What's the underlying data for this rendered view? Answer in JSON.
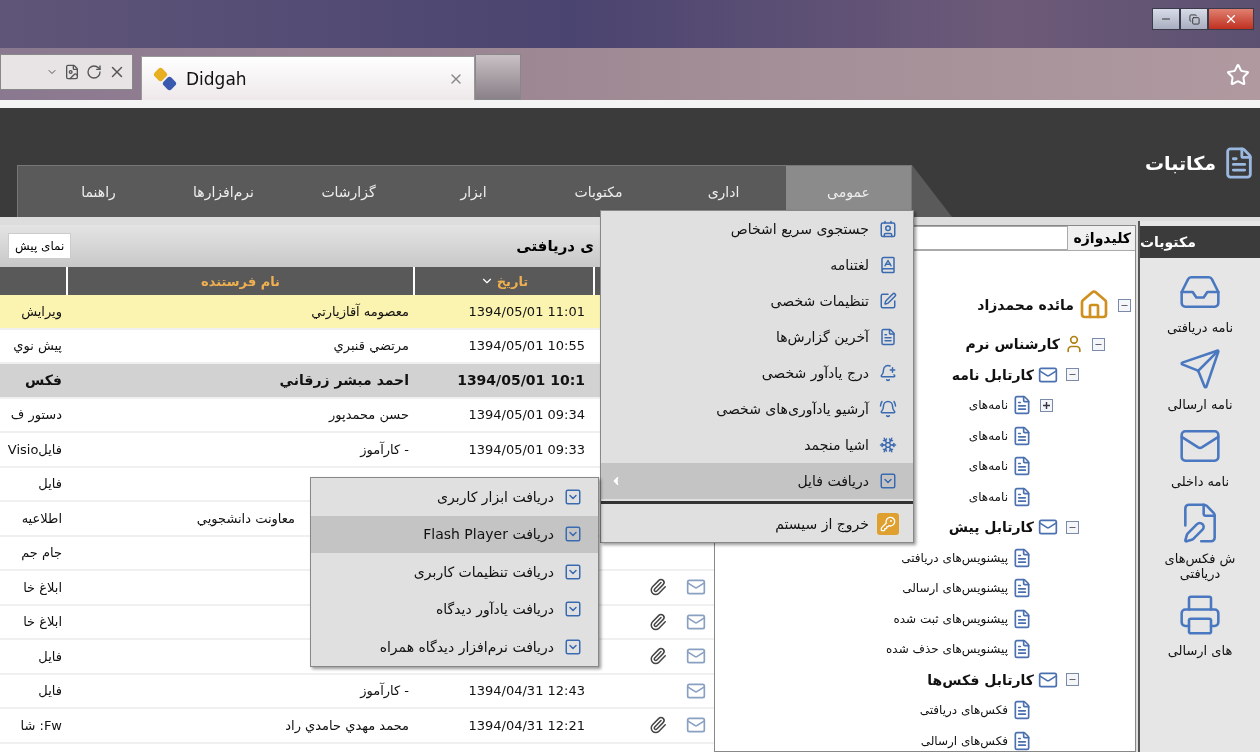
{
  "browser": {
    "tab": {
      "title": "Didgah"
    }
  },
  "app": {
    "title": "مکاتبات",
    "menu": [
      {
        "label": "عمومی",
        "selected": true
      },
      {
        "label": "اداری",
        "selected": false
      },
      {
        "label": "مکتوبات",
        "selected": false
      },
      {
        "label": "ابزار",
        "selected": false
      },
      {
        "label": "گزارشات",
        "selected": false
      },
      {
        "label": "نرم‌افزارها",
        "selected": false
      },
      {
        "label": "راهنما",
        "selected": false
      }
    ]
  },
  "dropdown": {
    "items": [
      {
        "label": "جستجوی سریع اشخاص",
        "highlighted": false
      },
      {
        "label": "لغتنامه",
        "highlighted": false
      },
      {
        "label": "تنظیمات شخصی",
        "highlighted": false
      },
      {
        "label": "آخرین گزارش‌ها",
        "highlighted": false
      },
      {
        "label": "درج یادآور شخصی",
        "highlighted": false
      },
      {
        "label": "آرشیو یادآوری‌های شخصی",
        "highlighted": false
      },
      {
        "label": "اشیا منجمد",
        "highlighted": false
      },
      {
        "label": "دریافت فایل",
        "highlighted": true,
        "submenu": [
          {
            "label": "دریافت ابزار کاربری",
            "highlighted": false
          },
          {
            "label": "دریافت Flash Player",
            "highlighted": true
          },
          {
            "label": "دریافت تنظیمات کاربری",
            "highlighted": false
          },
          {
            "label": "دریافت یادآور دیدگاه",
            "highlighted": false
          },
          {
            "label": "دریافت نرم‌افزار دیدگاه همراه",
            "highlighted": false
          }
        ]
      }
    ],
    "footer_items": [
      {
        "label": "خروج از سیستم",
        "highlighted": false
      }
    ]
  },
  "sidebar": {
    "title": "مکتوبات",
    "items": [
      {
        "label": "نامه دریافتی"
      },
      {
        "label": "نامه ارسالی"
      },
      {
        "label": "نامه داخلی"
      },
      {
        "label": "ش فکس‌های دریافتی"
      },
      {
        "label": "های ارسالی"
      }
    ]
  },
  "tree": {
    "search_label": "کلیدواژه",
    "nodes": [
      {
        "label": "مائده محمدزاد",
        "expanded": true,
        "children": [
          {
            "label": "کارشناس نرم",
            "expanded": true,
            "children": [
              {
                "label": "کارتابل نامه",
                "expanded": true,
                "children": [
                  {
                    "label": "نامه‌های",
                    "expanded": false
                  },
                  {
                    "label": "نامه‌های"
                  },
                  {
                    "label": "نامه‌های"
                  },
                  {
                    "label": "نامه‌های"
                  }
                ]
              },
              {
                "label": "کارتابل پیش",
                "expanded": true,
                "children": [
                  {
                    "label": "پیشنویس‌های دریافتی"
                  },
                  {
                    "label": "پیشنویس‌های ارسالی"
                  },
                  {
                    "label": "پیشنویس‌های ثبت شده"
                  },
                  {
                    "label": "پیشنویس‌های حذف شده"
                  }
                ]
              },
              {
                "label": "کارتابل فکس‌ها",
                "expanded": true,
                "children": [
                  {
                    "label": "فکس‌های دریافتی"
                  },
                  {
                    "label": "فکس‌های ارسالی"
                  }
                ]
              }
            ]
          }
        ]
      }
    ]
  },
  "inbox": {
    "title": "ی دریافتی",
    "preview_button": "نمای پیش",
    "columns": [
      {
        "label": "تاریخ",
        "sorted": true
      },
      {
        "label": "نام فرستنده",
        "sorted": false
      }
    ],
    "rows": [
      {
        "date": "1394/05/01 11:01",
        "sender": "معصومه آقازيارتي",
        "subject": "ويرايش",
        "selected": true,
        "unread": false
      },
      {
        "date": "1394/05/01 10:55",
        "sender": "مرتضي قنبري",
        "subject": "پيش نوي",
        "selected": false,
        "unread": false
      },
      {
        "date": "1394/05/01 10:1",
        "sender": "احمد مبشر زرقاني",
        "subject": "فكس",
        "selected": false,
        "unread": true
      },
      {
        "date": "1394/05/01 09:34",
        "sender": "حسن محمدپور",
        "subject": "دستور ف",
        "selected": false,
        "unread": false
      },
      {
        "date": "1394/05/01 09:33",
        "sender": "- كارآموز",
        "subject": "فايلVisio",
        "selected": false,
        "unread": false
      },
      {
        "subject": "فايل",
        "selected": false,
        "unread": false
      },
      {
        "sender": "معاونت دانشجويي",
        "subject": "اطلاعيه",
        "selected": false,
        "unread": false
      },
      {
        "subject": "جام جم",
        "selected": false,
        "unread": false
      },
      {
        "subject": "ابلاغ خا",
        "selected": false,
        "unread": false,
        "attachment": true
      },
      {
        "subject": "ابلاغ خا",
        "selected": false,
        "unread": false,
        "attachment": true
      },
      {
        "subject": "فايل",
        "selected": false,
        "unread": false,
        "attachment": true
      },
      {
        "date": "1394/04/31 12:43",
        "sender": "- كارآموز",
        "subject": "فايل",
        "selected": false,
        "unread": false,
        "attachment": false
      },
      {
        "date": "1394/04/31 12:21",
        "sender": "محمد مهدي حامدي راد",
        "subject": "Fw: شا",
        "selected": false,
        "unread": false,
        "attachment": true
      }
    ]
  }
}
